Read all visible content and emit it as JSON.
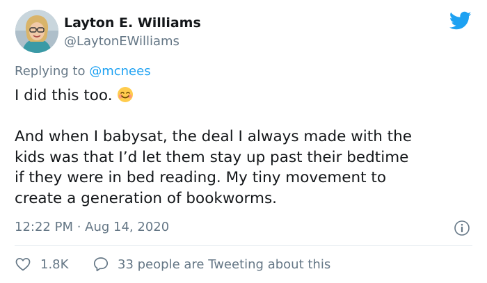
{
  "author": {
    "name": "Layton E. Williams",
    "handle": "@LaytonEWilliams"
  },
  "reply_context": {
    "prefix": "Replying to ",
    "mention": "@mcnees"
  },
  "tweet_text": {
    "line1": "I did this too.",
    "emoji": "smiling-face-with-hearts-emoji",
    "line2": "And when I babysat, the deal I always made with the",
    "line3": "kids was that I’d let them stay up past their bedtime",
    "line4": "if they were in bed reading. My tiny movement to",
    "line5": "create a generation of bookworms."
  },
  "meta": {
    "time": "12:22 PM",
    "separator": " · ",
    "date": "Aug 14, 2020"
  },
  "actions": {
    "likes": "1.8K",
    "replies_text": "33 people are Tweeting about this"
  },
  "icons": {
    "brand": "twitter-bird-icon",
    "info": "info-icon",
    "like": "heart-icon",
    "reply": "speech-bubble-icon"
  },
  "colors": {
    "brand_blue": "#1da1f2",
    "text": "#14171a",
    "secondary": "#657786",
    "divider": "#e1e8ed"
  }
}
